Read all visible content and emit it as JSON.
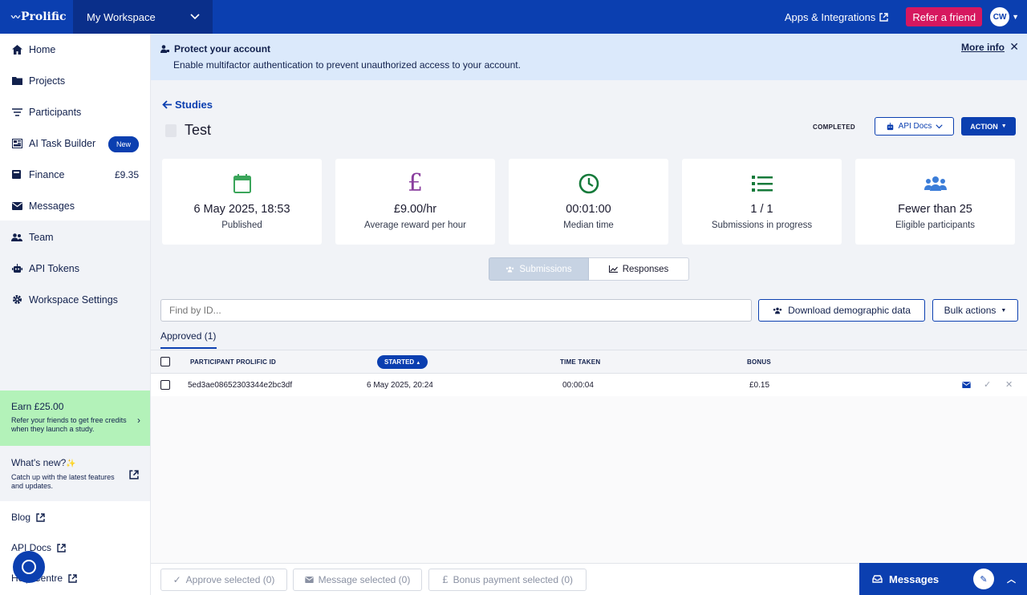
{
  "topbar": {
    "brand": "Prolific",
    "workspace": "My Workspace",
    "apps_link": "Apps & Integrations",
    "refer_button": "Refer a friend",
    "avatar_initials": "CW"
  },
  "sidebar": {
    "items": [
      {
        "label": "Home",
        "icon": "home-icon"
      },
      {
        "label": "Projects",
        "icon": "folder-icon"
      },
      {
        "label": "Participants",
        "icon": "filter-icon"
      },
      {
        "label": "AI Task Builder",
        "icon": "grid-icon",
        "badge": "New"
      },
      {
        "label": "Finance",
        "icon": "wallet-icon",
        "value": "£9.35"
      },
      {
        "label": "Messages",
        "icon": "envelope-icon"
      },
      {
        "label": "Team",
        "icon": "team-icon"
      },
      {
        "label": "API Tokens",
        "icon": "robot-icon"
      },
      {
        "label": "Workspace Settings",
        "icon": "gear-icon"
      }
    ],
    "earn": {
      "title": "Earn £25.00",
      "desc": "Refer your friends to get free credits when they launch a study."
    },
    "whats_new": {
      "title": "What's new?",
      "desc": "Catch up with the latest features and updates."
    },
    "footer_links": [
      "Blog",
      "API Docs",
      "Help Centre"
    ]
  },
  "banner": {
    "title": "Protect your account",
    "desc": "Enable multifactor authentication to prevent unauthorized access to your account.",
    "more_info": "More info"
  },
  "study": {
    "back_label": "Studies",
    "title": "Test",
    "status": "COMPLETED",
    "api_docs": "API Docs",
    "action": "ACTION"
  },
  "cards": [
    {
      "value": "6 May 2025, 18:53",
      "label": "Published",
      "icon": "calendar-icon"
    },
    {
      "value": "£9.00/hr",
      "label": "Average reward per hour",
      "icon": "pound-icon"
    },
    {
      "value": "00:01:00",
      "label": "Median time",
      "icon": "clock-icon"
    },
    {
      "value": "1 / 1",
      "label": "Submissions in progress",
      "icon": "list-icon"
    },
    {
      "value": "Fewer than 25",
      "label": "Eligible participants",
      "icon": "users-icon"
    }
  ],
  "view_toggle": {
    "submissions": "Submissions",
    "responses": "Responses"
  },
  "search": {
    "placeholder": "Find by ID..."
  },
  "download_button": "Download demographic data",
  "bulk_button": "Bulk actions",
  "tab_approved": "Approved (1)",
  "table": {
    "headers": {
      "id": "PARTICIPANT PROLIFIC ID",
      "started": "STARTED",
      "time": "TIME TAKEN",
      "bonus": "BONUS"
    },
    "rows": [
      {
        "id": "5ed3ae08652303344e2bc3df",
        "started": "6 May 2025, 20:24",
        "time": "00:00:04",
        "bonus": "£0.15"
      }
    ]
  },
  "bottom_actions": {
    "approve": "Approve selected (0)",
    "message": "Message selected (0)",
    "bonus": "Bonus payment selected (0)"
  },
  "messages_panel": {
    "label": "Messages"
  },
  "colors": {
    "primary": "#0b3fb0",
    "refer": "#d6185f",
    "earn_bg": "#b3f2b9",
    "banner_bg": "#dbe9fb"
  }
}
